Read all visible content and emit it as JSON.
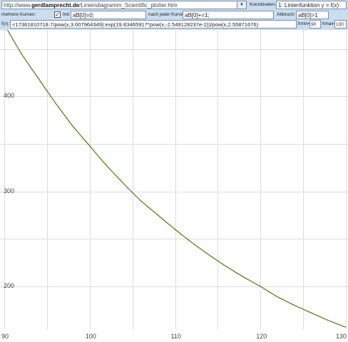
{
  "toolbar": {
    "url_prefix": "http://www.",
    "url_domain": "gerdlamprecht.de",
    "url_path": "/Liniendiagramm_Scientific_plotter.htm",
    "coordinates_label": "Koordinaten:",
    "coordinates_value": "1: Linienfunktion y = f(x)",
    "multi_curves_label": "mehrere Kurven:",
    "multi_curves_checked": true,
    "init_label": "Init:",
    "init_value": "aB[0]=0;",
    "after_each_label": "nach jeder Kurve:",
    "after_each_value": "aB[0]+=1;",
    "abort_label": "Abbruch:",
    "abort_value": "aB[0]>1",
    "fx_label": "f(x):",
    "fx_value": "<1?361810718.7/pow(x,3.007964349):exp(19.83465917*pow(x,-2.549128237e-2))/pow(x,2.55871676)",
    "xmin_label": "Xmin=",
    "xmin_value": "90",
    "xmax_label": "Xmax=",
    "xmax_value": "130"
  },
  "chart_data": {
    "type": "line",
    "xlim": [
      90,
      130
    ],
    "ylim": [
      155,
      470
    ],
    "x_ticks": [
      90,
      100,
      110,
      120,
      130
    ],
    "y_ticks": [
      200,
      300,
      400
    ],
    "x_tick_labels": [
      "90",
      "100",
      "110",
      "120",
      "130"
    ],
    "y_tick_labels": [
      "200",
      "300",
      "400"
    ],
    "grid": true,
    "line_color": "#4a7a12",
    "series": [
      {
        "x": [
          90,
          92,
          94,
          96,
          98,
          100,
          102,
          104,
          106,
          108,
          110,
          112,
          114,
          116,
          118,
          120,
          122,
          124,
          126,
          128,
          130
        ],
        "y": [
          476,
          445,
          419,
          393,
          369,
          348,
          327,
          308,
          290,
          275,
          260,
          246,
          233,
          221,
          210,
          200,
          189,
          180,
          172,
          164,
          157
        ]
      }
    ]
  }
}
